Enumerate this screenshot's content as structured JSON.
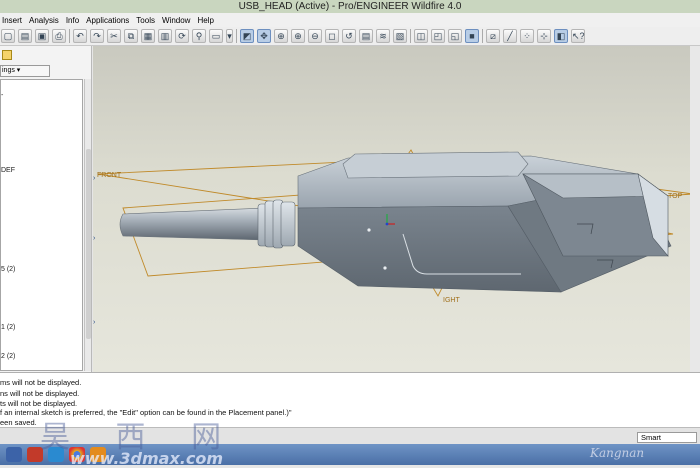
{
  "window": {
    "title": "USB_HEAD (Active) - Pro/ENGINEER Wildfire 4.0"
  },
  "menubar": {
    "items": [
      "Insert",
      "Analysis",
      "Info",
      "Applications",
      "Tools",
      "Window",
      "Help"
    ]
  },
  "left_panel": {
    "dropdown_label": "ings ▾",
    "tree_items": [
      "-",
      "DEF",
      "5 (2)",
      "1 (2)",
      "2 (2)"
    ]
  },
  "graphics": {
    "datum_labels": {
      "front": "FRONT",
      "top": "TOP",
      "right": "IGHT"
    }
  },
  "messages": [
    "ms will not be displayed.",
    "ns will not be displayed.",
    "ts will not be displayed.",
    "f an internal sketch is preferred, the \"Edit\" option can be found in the Placement panel.)\"",
    "een saved."
  ],
  "statusbar": {
    "filter_value": "Smart"
  },
  "watermark": {
    "chars": "昊 西 网",
    "url": "www.3dmax.com",
    "signature": "Kangnan"
  },
  "colors": {
    "title_bg": "#c9d6bf",
    "taskbar": "#4a6fa6",
    "datum_plane": "#c08a2a",
    "model_body": "#8c96a1"
  }
}
